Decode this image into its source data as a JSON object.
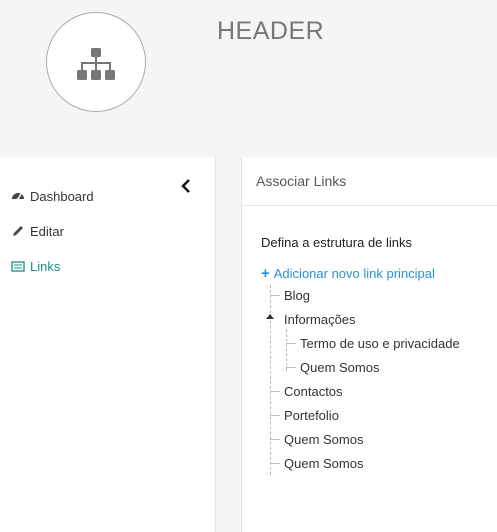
{
  "header": {
    "title": "HEADER",
    "logo_icon": "sitemap-icon"
  },
  "sidebar": {
    "items": [
      {
        "label": "Dashboard",
        "icon": "dashboard-icon"
      },
      {
        "label": "Editar",
        "icon": "pencil-icon"
      },
      {
        "label": "Links",
        "icon": "list-icon",
        "active": true
      }
    ]
  },
  "panel": {
    "title": "Associar Links",
    "intro": "Defina a estrutura de links",
    "add_label": "Adicionar novo link principal",
    "tree": [
      {
        "label": "Blog"
      },
      {
        "label": "Informações",
        "expanded": true,
        "children": [
          {
            "label": "Termo de uso e privacidade"
          },
          {
            "label": "Quem Somos"
          }
        ]
      },
      {
        "label": "Contactos"
      },
      {
        "label": "Portefolio"
      },
      {
        "label": "Quem Somos"
      },
      {
        "label": "Quem Somos"
      }
    ]
  },
  "colors": {
    "accent": "#1a8f8f",
    "link": "#2a8fd6"
  }
}
